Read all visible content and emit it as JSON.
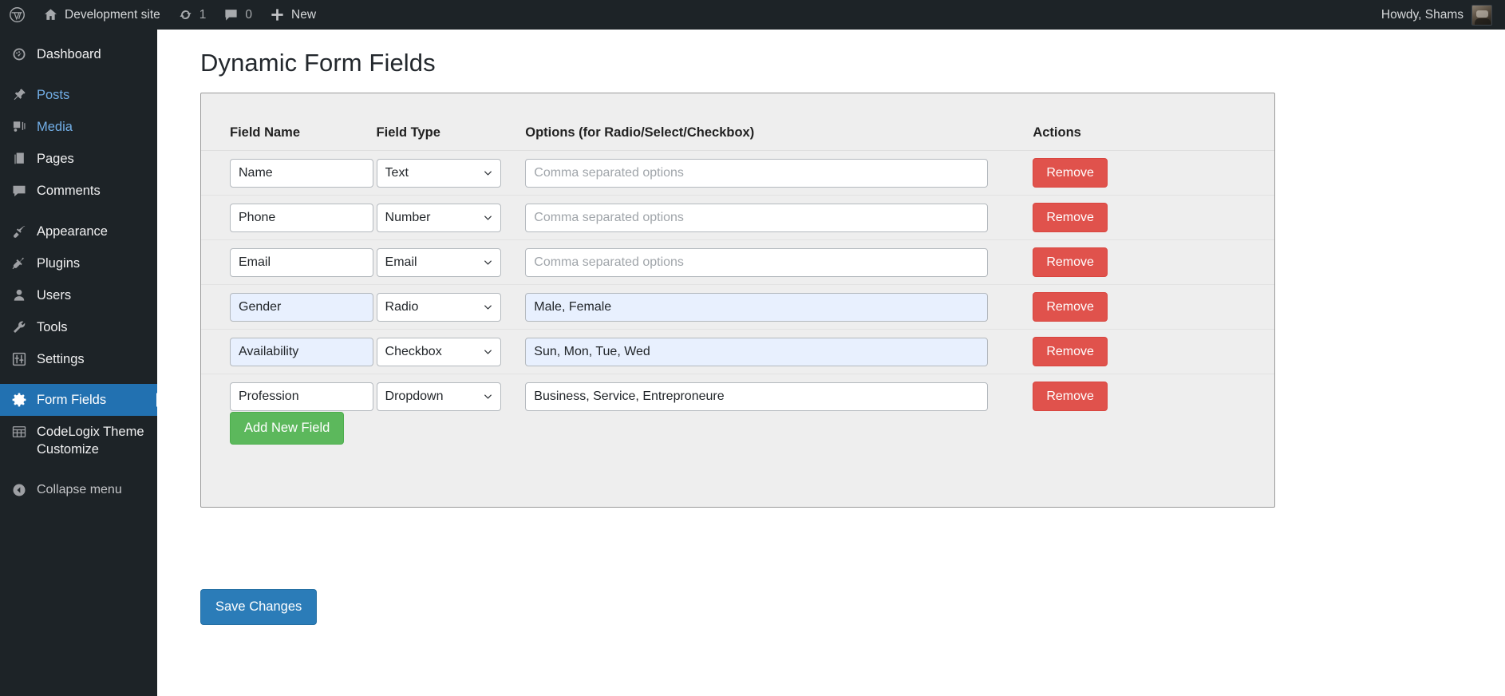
{
  "adminbar": {
    "logo_icon": "wordpress-logo-icon",
    "site": {
      "icon": "home-icon",
      "label": "Development site"
    },
    "updates": {
      "icon": "updates-icon",
      "count": "1"
    },
    "comments": {
      "icon": "comment-bubble-icon",
      "count": "0"
    },
    "new": {
      "icon": "plus-icon",
      "label": "New"
    },
    "account": {
      "greeting": "Howdy, Shams",
      "avatar": "user-avatar"
    }
  },
  "sidebar": {
    "items": [
      {
        "label": "Dashboard",
        "icon": "dashboard-icon",
        "state": "normal"
      },
      {
        "label": "Posts",
        "icon": "pin-icon",
        "state": "link"
      },
      {
        "label": "Media",
        "icon": "media-icon",
        "state": "link"
      },
      {
        "label": "Pages",
        "icon": "pages-icon",
        "state": "normal"
      },
      {
        "label": "Comments",
        "icon": "comment-bubble-icon",
        "state": "normal"
      },
      {
        "label": "Appearance",
        "icon": "paintbrush-icon",
        "state": "normal"
      },
      {
        "label": "Plugins",
        "icon": "plug-icon",
        "state": "normal"
      },
      {
        "label": "Users",
        "icon": "user-icon",
        "state": "normal"
      },
      {
        "label": "Tools",
        "icon": "wrench-icon",
        "state": "normal"
      },
      {
        "label": "Settings",
        "icon": "sliders-icon",
        "state": "normal"
      },
      {
        "label": "Form Fields",
        "icon": "gear-icon",
        "state": "current"
      },
      {
        "label": "CodeLogix Theme Customize",
        "icon": "table-icon",
        "state": "normal"
      }
    ],
    "collapse": {
      "label": "Collapse menu",
      "icon": "collapse-arrow-icon"
    },
    "current_color": "#2271b1"
  },
  "main": {
    "page_title": "Dynamic Form Fields",
    "table": {
      "headers": {
        "field_name": "Field Name",
        "field_type": "Field Type",
        "options": "Options (for Radio/Select/Checkbox)",
        "actions": "Actions"
      },
      "options_placeholder": "Comma separated options",
      "type_choices": [
        "Text",
        "Number",
        "Email",
        "Radio",
        "Checkbox",
        "Dropdown"
      ],
      "remove_label": "Remove",
      "rows": [
        {
          "name": "Name",
          "type": "Text",
          "options": "",
          "highlighted": false
        },
        {
          "name": "Phone",
          "type": "Number",
          "options": "",
          "highlighted": false
        },
        {
          "name": "Email",
          "type": "Email",
          "options": "",
          "highlighted": false
        },
        {
          "name": "Gender",
          "type": "Radio",
          "options": "Male, Female",
          "highlighted": true
        },
        {
          "name": "Availability",
          "type": "Checkbox",
          "options": "Sun, Mon, Tue, Wed",
          "highlighted": true
        },
        {
          "name": "Profession",
          "type": "Dropdown",
          "options": "Business, Service, Entreproneure",
          "highlighted": false
        }
      ]
    },
    "add_new_label": "Add New Field",
    "save_label": "Save Changes",
    "colors": {
      "add_new": "#5cb85c",
      "remove": "#e0524c",
      "save": "#2b7cb8",
      "panel_bg": "#eeeeee",
      "autofill": "#e8f0fe"
    }
  }
}
